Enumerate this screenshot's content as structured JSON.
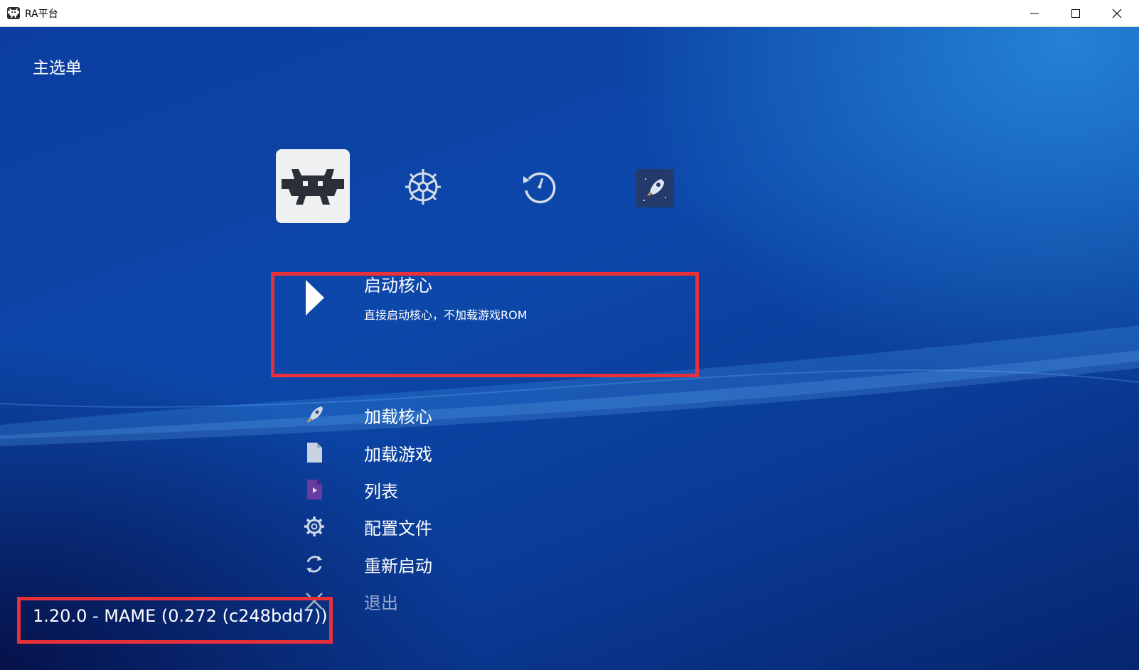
{
  "window": {
    "title": "RA平台",
    "icons": [
      "retroarch-icon",
      "minimize-icon",
      "maximize-icon",
      "close-icon"
    ]
  },
  "header": {
    "title": "主选单"
  },
  "tabs": [
    {
      "icon": "retroarch-icon",
      "selected": true
    },
    {
      "icon": "settings-gear-icon",
      "selected": false
    },
    {
      "icon": "history-icon",
      "selected": false
    },
    {
      "icon": "explore-rocket-icon",
      "selected": false
    }
  ],
  "menu": {
    "selected": {
      "label": "启动核心",
      "sublabel": "直接启动核心，不加载游戏ROM",
      "icon": "play-icon"
    },
    "items": [
      {
        "label": "加载核心",
        "icon": "rocket-icon"
      },
      {
        "label": "加载游戏",
        "icon": "file-icon"
      },
      {
        "label": "列表",
        "icon": "playlist-icon"
      },
      {
        "label": "配置文件",
        "icon": "gear-icon"
      },
      {
        "label": "重新启动",
        "icon": "restart-icon"
      },
      {
        "label": "退出",
        "icon": "quit-x-icon"
      }
    ]
  },
  "footer": {
    "version": "1.20.0 - MAME (0.272 (c248bdd7))"
  },
  "colors": {
    "highlight_border": "#e8303a",
    "background_top": "#0c48aa",
    "background_bottom": "#06256e",
    "playlist_icon": "#6a3aa0"
  }
}
